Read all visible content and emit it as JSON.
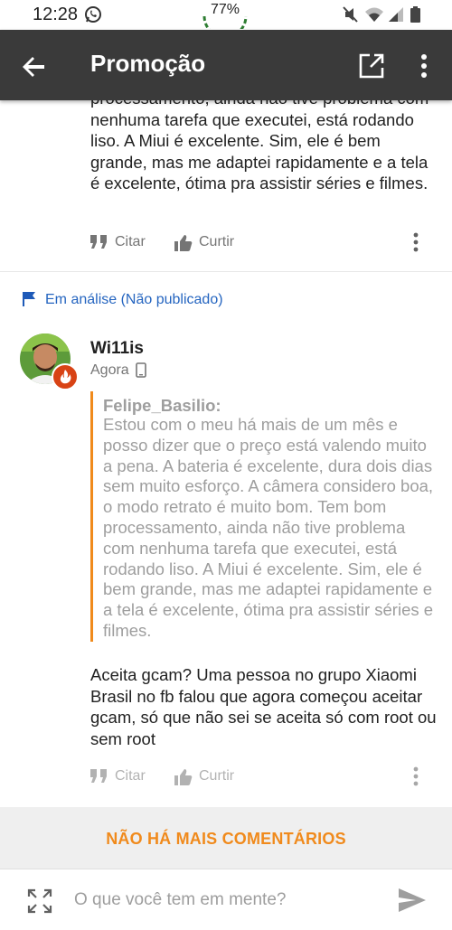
{
  "status_bar": {
    "time": "12:28",
    "battery_percent": "77%",
    "icons": [
      "whatsapp-icon",
      "mute-icon",
      "wifi-icon",
      "signal-icon",
      "battery-icon"
    ]
  },
  "app_bar": {
    "title": "Promoção",
    "color": "#3a3a3a"
  },
  "previous_comment": {
    "text": "processamento, ainda não tive problema com nenhuma tarefa que executei, está rodando liso. A Miui é excelente. Sim, ele é bem grande, mas me adaptei rapidamente e a tela é excelente, ótima pra assistir séries e filmes.",
    "actions": {
      "quote_label": "Citar",
      "like_label": "Curtir"
    }
  },
  "pending_comment": {
    "moderation_label": "Em análise (Não publicado)",
    "author": "Wi11is",
    "time": "Agora",
    "quote": {
      "author": "Felipe_Basilio:",
      "text": "Estou com o meu há mais de um mês e posso dizer que o preço está valendo muito a pena. A bateria é excelente, dura dois dias sem muito esforço. A câmera considero boa, o modo retrato é muito bom. Tem bom processamento, ainda não tive problema com nenhuma tarefa que executei, está rodando liso. A Miui é excelente. Sim, ele é bem grande, mas me adaptei rapidamente e a tela é excelente, ótima pra assistir séries e filmes."
    },
    "text": "Aceita gcam? Uma pessoa no grupo Xiaomi Brasil no fb falou que agora começou aceitar gcam, só que não sei se aceita só com root ou sem root",
    "actions": {
      "quote_label": "Citar",
      "like_label": "Curtir"
    }
  },
  "footer": {
    "no_more_comments": "NÃO HÁ MAIS COMENTÁRIOS",
    "accent": "#f08a1c"
  },
  "composer": {
    "placeholder": "O que você tem em mente?",
    "value": ""
  }
}
